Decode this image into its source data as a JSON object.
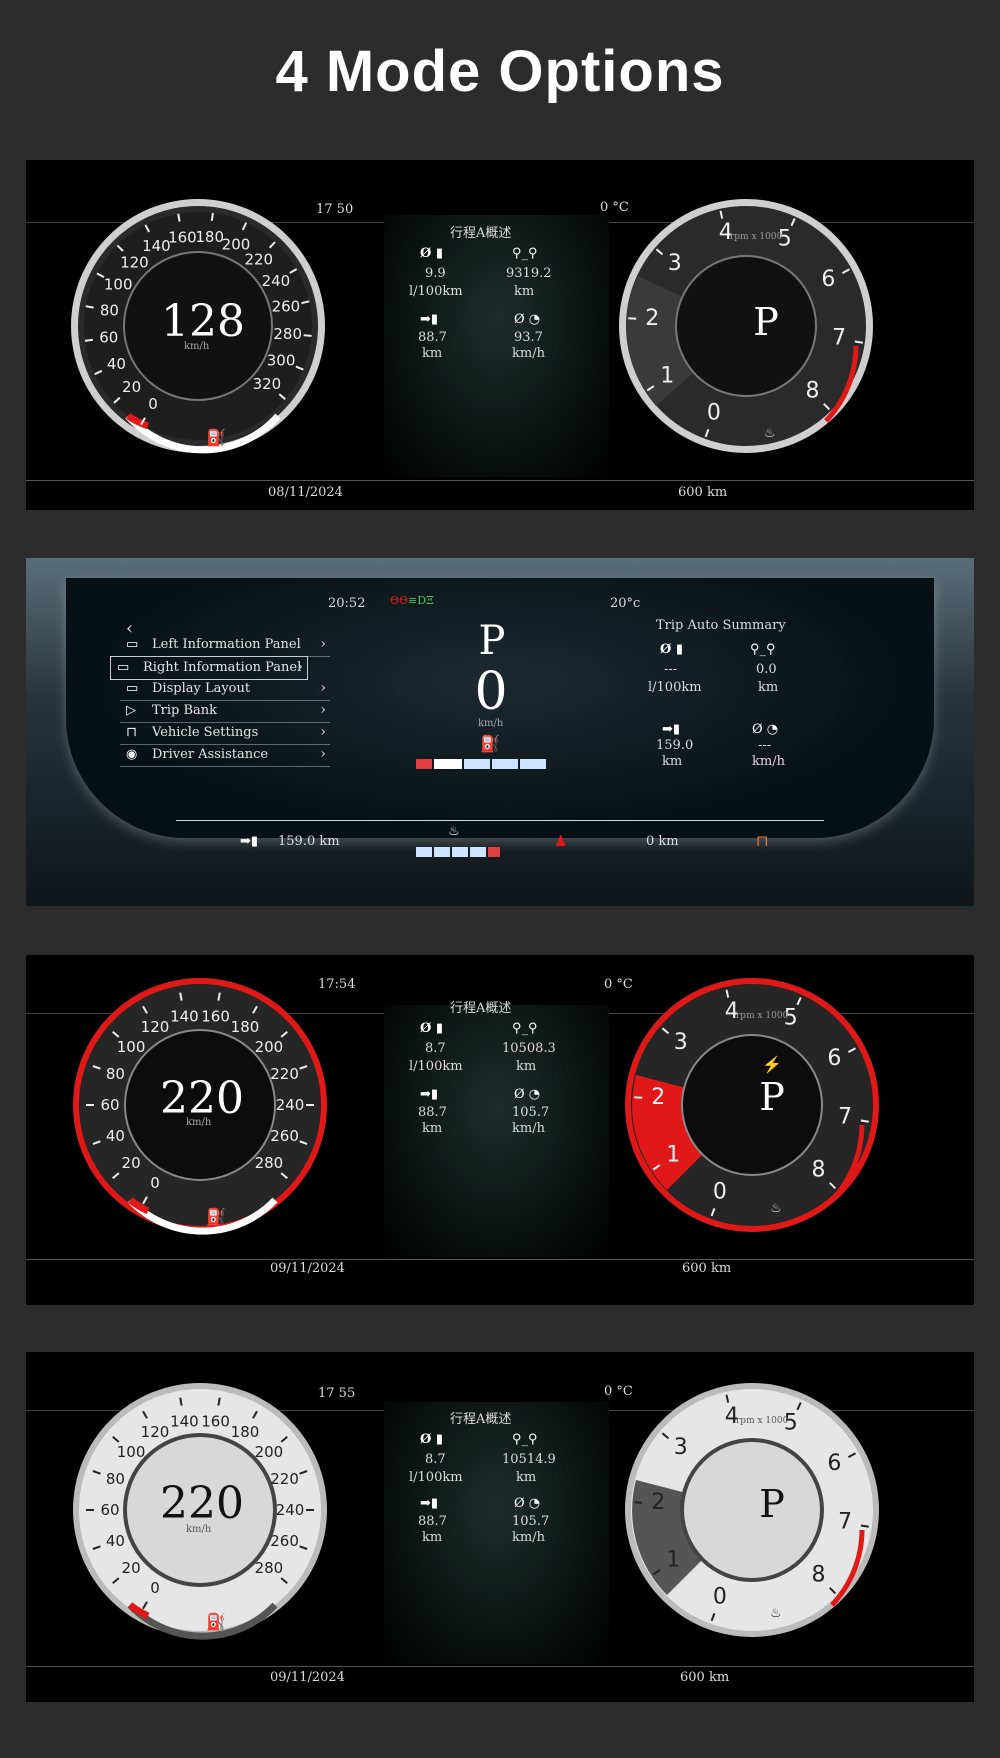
{
  "page": {
    "title": "4 Mode Options"
  },
  "mode1": {
    "time": "17 50",
    "temp": "0 °C",
    "date": "08/11/2024",
    "range": "600   km",
    "speed": "128",
    "speed_unit": "km/h",
    "gear": "P",
    "rpm_unit": "rpm x 1000",
    "summary_title": "行程A概述",
    "avg_fuel_value": "9.9",
    "avg_fuel_unit": "l/100km",
    "distance_value": "9319.2",
    "distance_unit": "km",
    "range_value": "88.7",
    "range_unit": "km",
    "avg_speed_value": "93.7",
    "avg_speed_unit": "km/h",
    "speed_ticks": [
      "0",
      "20",
      "40",
      "60",
      "80",
      "100",
      "120",
      "140",
      "160",
      "180",
      "200",
      "220",
      "240",
      "260",
      "280",
      "300",
      "320"
    ],
    "rpm_ticks": [
      "0",
      "1",
      "2",
      "3",
      "4",
      "5",
      "6",
      "7",
      "8"
    ]
  },
  "mode2": {
    "time": "20:52",
    "temp": "20°c",
    "gear": "P",
    "speed": "0",
    "speed_unit": "km/h",
    "back_label": "‹",
    "menu": [
      {
        "label": "Left Information Panel"
      },
      {
        "label": "Right Information Panel"
      },
      {
        "label": "Display Layout"
      },
      {
        "label": "Trip Bank"
      },
      {
        "label": "Vehicle Settings"
      },
      {
        "label": "Driver Assistance"
      }
    ],
    "summary_title": "Trip Auto Summary",
    "avg_fuel_value": "---",
    "avg_fuel_unit": "l/100km",
    "distance_value": "0.0",
    "distance_unit": "km",
    "range_value": "159.0",
    "range_unit": "km",
    "avg_speed_value": "---",
    "avg_speed_unit": "km/h",
    "bottom_range": "159.0  km",
    "bottom_trip": "0   km"
  },
  "mode3": {
    "time": "17:54",
    "temp": "0 °C",
    "date": "09/11/2024",
    "range": "600   km",
    "speed": "220",
    "speed_unit": "km/h",
    "gear": "P",
    "rpm_unit": "rpm x 1000",
    "summary_title": "行程A概述",
    "avg_fuel_value": "8.7",
    "avg_fuel_unit": "l/100km",
    "distance_value": "10508.3",
    "distance_unit": "km",
    "range_value": "88.7",
    "range_unit": "km",
    "avg_speed_value": "105.7",
    "avg_speed_unit": "km/h",
    "speed_ticks": [
      "0",
      "20",
      "40",
      "60",
      "80",
      "100",
      "120",
      "140",
      "160",
      "180",
      "200",
      "220",
      "240",
      "260",
      "280"
    ],
    "rpm_ticks": [
      "0",
      "1",
      "2",
      "3",
      "4",
      "5",
      "6",
      "7",
      "8"
    ]
  },
  "mode4": {
    "time": "17 55",
    "temp": "0 °C",
    "date": "09/11/2024",
    "range": "600   km",
    "speed": "220",
    "speed_unit": "km/h",
    "gear": "P",
    "rpm_unit": "rpm x 1000",
    "summary_title": "行程A概述",
    "avg_fuel_value": "8.7",
    "avg_fuel_unit": "l/100km",
    "distance_value": "10514.9",
    "distance_unit": "km",
    "range_value": "88.7",
    "range_unit": "km",
    "avg_speed_value": "105.7",
    "avg_speed_unit": "km/h",
    "speed_ticks": [
      "0",
      "20",
      "40",
      "60",
      "80",
      "100",
      "120",
      "140",
      "160",
      "180",
      "200",
      "220",
      "240",
      "260",
      "280"
    ],
    "rpm_ticks": [
      "0",
      "1",
      "2",
      "3",
      "4",
      "5",
      "6",
      "7",
      "8"
    ]
  },
  "icons": {
    "avg_fuel": "avg-fuel-icon",
    "distance": "route-icon",
    "range": "fuel-range-icon",
    "avg_speed": "speedometer-icon",
    "fuel": "fuel-pump-icon",
    "coolant": "coolant-temp-icon"
  },
  "colors": {
    "accent_red": "#e01818",
    "panel_bg": "#000000",
    "page_bg": "#2c2c2c"
  }
}
